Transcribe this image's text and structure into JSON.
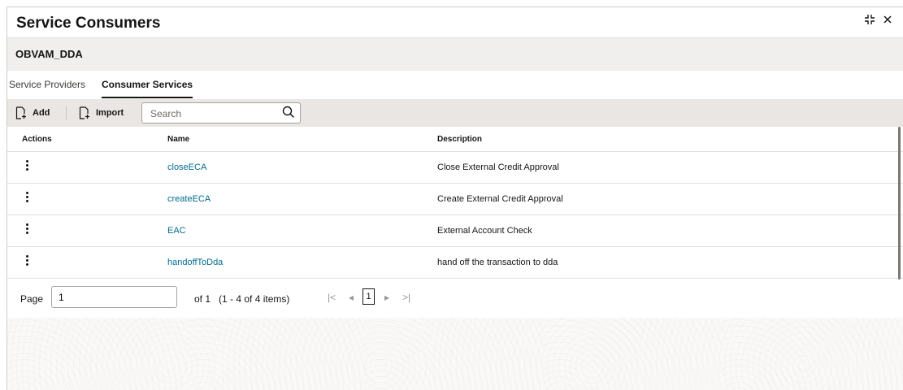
{
  "window": {
    "title": "Service Consumers",
    "collapse_icon": "collapse-icon",
    "close_icon": "close-icon"
  },
  "subtitle": "OBVAM_DDA",
  "tabs": [
    {
      "label": "Service Providers",
      "active": false
    },
    {
      "label": "Consumer Services",
      "active": true
    }
  ],
  "toolbar": {
    "add_label": "Add",
    "import_label": "Import",
    "search_placeholder": "Search",
    "search_value": ""
  },
  "table": {
    "headers": {
      "actions": "Actions",
      "name": "Name",
      "description": "Description"
    },
    "rows": [
      {
        "name": "closeECA",
        "description": "Close External Credit Approval"
      },
      {
        "name": "createECA",
        "description": "Create External Credit Approval"
      },
      {
        "name": "EAC",
        "description": "External Account Check"
      },
      {
        "name": "handoffToDda",
        "description": "hand off the transaction to dda"
      }
    ]
  },
  "pager": {
    "page_label": "Page",
    "page_value": "1",
    "of_text": "of 1",
    "items_text": "(1 - 4 of 4 items)",
    "first_glyph": "|<",
    "prev_glyph": "◂",
    "current": "1",
    "next_glyph": "▸",
    "last_glyph": ">|"
  },
  "colors": {
    "link": "#006b8f",
    "toolbar_bg": "#e9e6e3",
    "subtitle_bg": "#f1efed"
  }
}
